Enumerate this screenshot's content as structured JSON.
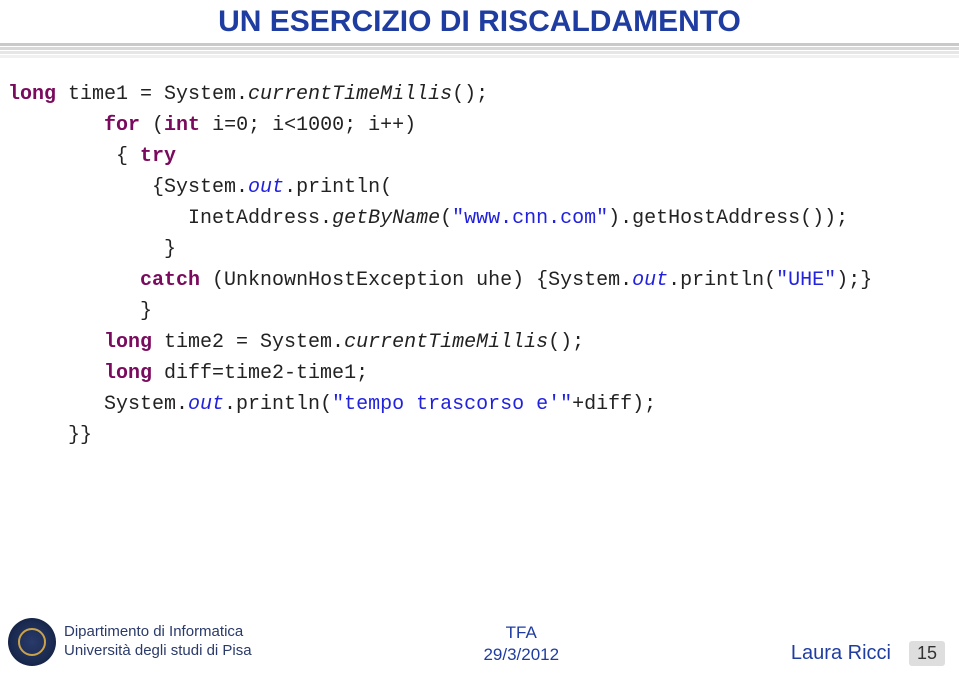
{
  "title": "UN ESERCIZIO DI RISCALDAMENTO",
  "code": {
    "l1_kw": "long",
    "l1_rest": " time1 = System.",
    "l1_it": "currentTimeMillis",
    "l1_end": "();",
    "l2_indent": "        ",
    "l2_kw": "for",
    "l2_rest": " (",
    "l2_kw2": "int",
    "l2_rest2": " i=0; i<1000; i++)",
    "l3": "         { ",
    "l3_kw": "try",
    "l4": "            {System.",
    "l4_it": "out",
    "l4_rest": ".println(",
    "l5": "               InetAddress.",
    "l5_it": "getByName",
    "l5_rest": "(",
    "l5_str": "\"www.cnn.com\"",
    "l5_end": ").getHostAddress());",
    "l6": "             }",
    "l7": "           ",
    "l7_kw": "catch",
    "l7_rest": " (UnknownHostException uhe) {System.",
    "l7_it": "out",
    "l7_rest2": ".println(",
    "l7_str": "\"UHE\"",
    "l7_end": ");}",
    "l8": "           }",
    "l9_indent": "        ",
    "l9_kw": "long",
    "l9_rest": " time2 = System.",
    "l9_it": "currentTimeMillis",
    "l9_end": "();",
    "l10_indent": "        ",
    "l10_kw": "long",
    "l10_rest": " diff=time2-time1;",
    "l11": "        System.",
    "l11_it": "out",
    "l11_rest": ".println(",
    "l11_str": "\"tempo trascorso e'\"",
    "l11_end": "+diff);",
    "l12": "     }}"
  },
  "footer": {
    "dept_line1": "Dipartimento di Informatica",
    "dept_line2": "Università degli studi di Pisa",
    "center_line1": "TFA",
    "center_line2": "29/3/2012",
    "author": "Laura Ricci",
    "page": "15"
  }
}
